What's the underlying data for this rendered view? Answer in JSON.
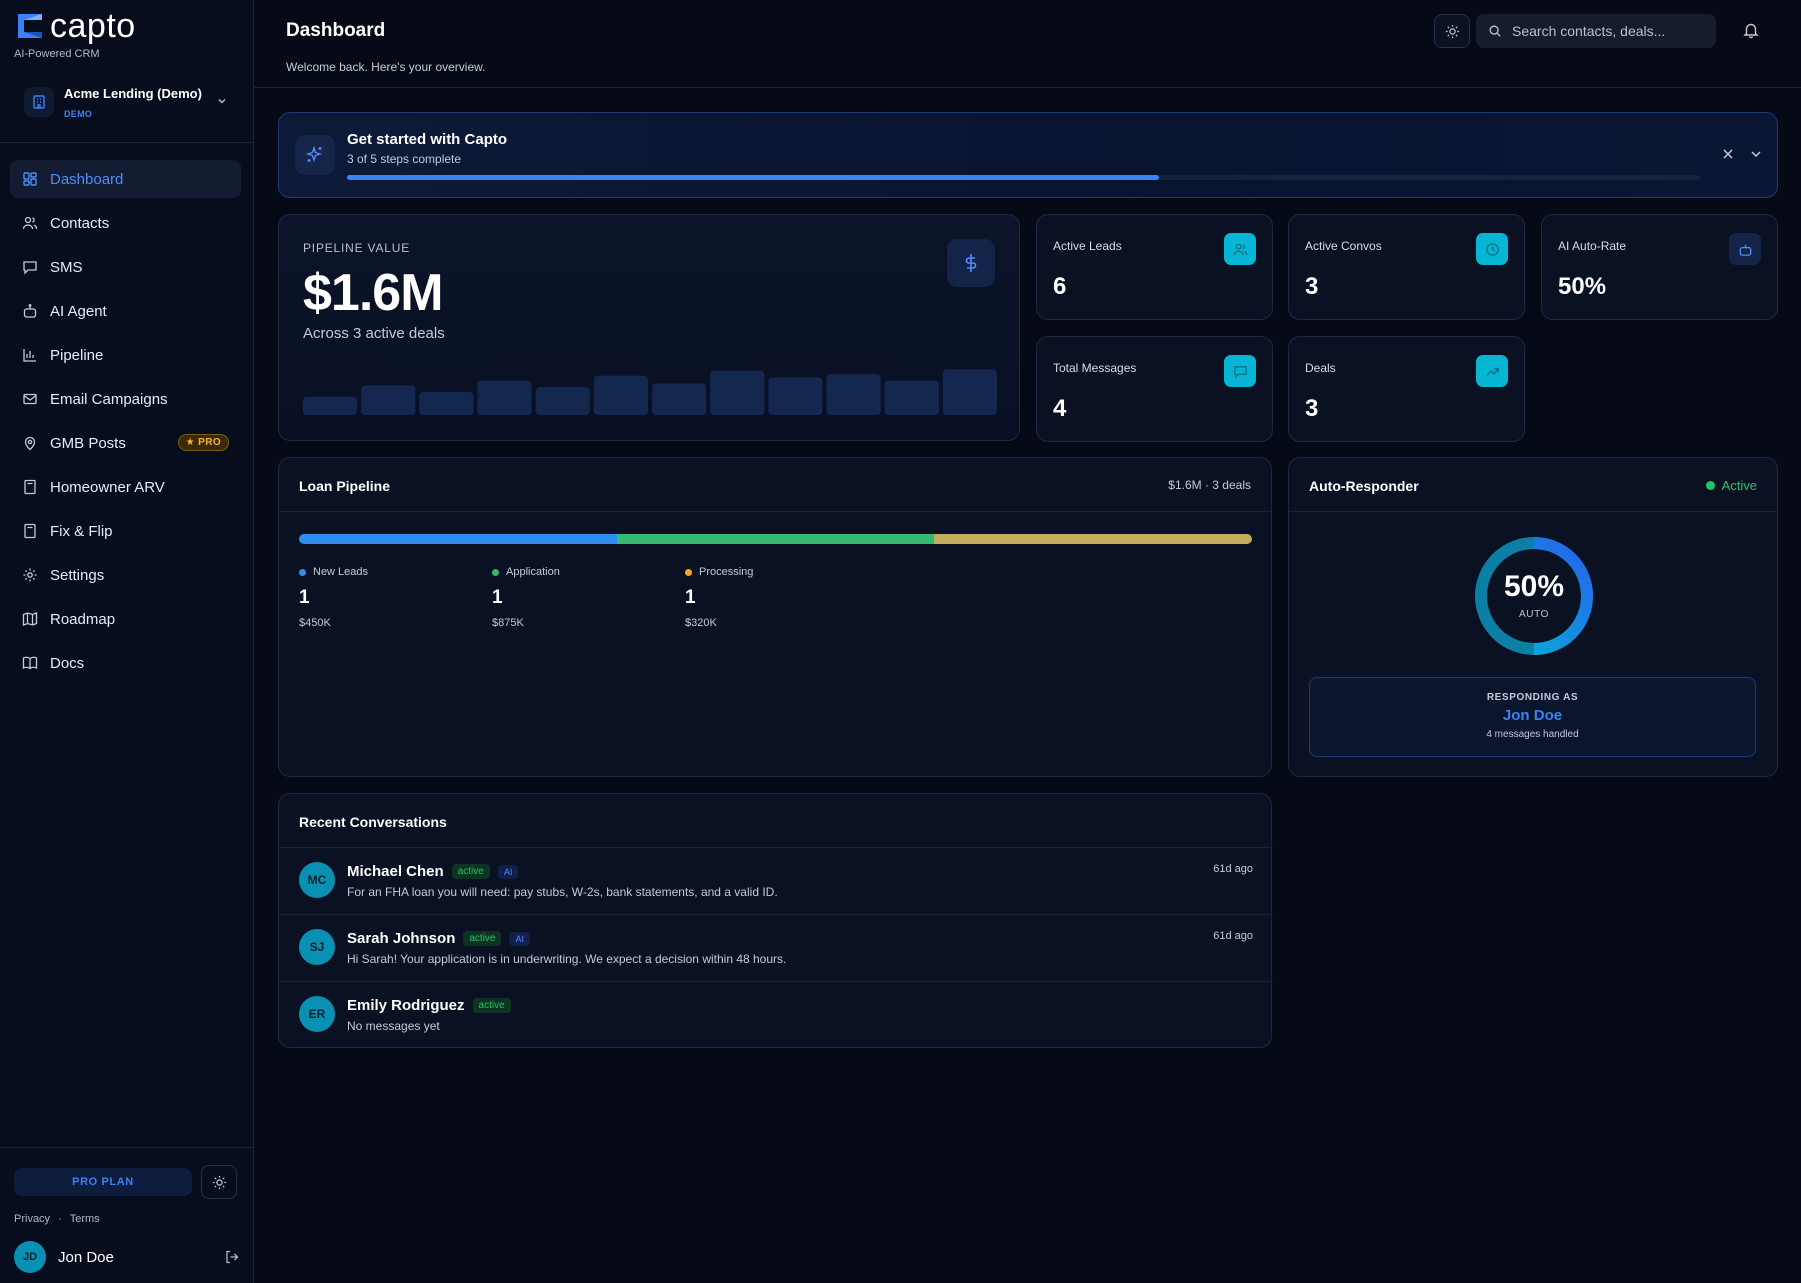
{
  "brand": {
    "name": "capto",
    "tagline": "AI-Powered CRM"
  },
  "org": {
    "name": "Acme Lending (Demo)",
    "badge": "DEMO"
  },
  "nav": [
    {
      "label": "Dashboard",
      "icon": "dashboard-icon",
      "active": true
    },
    {
      "label": "Contacts",
      "icon": "users-icon"
    },
    {
      "label": "SMS",
      "icon": "message-icon"
    },
    {
      "label": "AI Agent",
      "icon": "bot-icon"
    },
    {
      "label": "Pipeline",
      "icon": "bar-chart-icon"
    },
    {
      "label": "Email Campaigns",
      "icon": "mail-icon"
    },
    {
      "label": "GMB Posts",
      "icon": "map-pin-icon",
      "badge": "★ PRO"
    },
    {
      "label": "Homeowner ARV",
      "icon": "calculator-icon"
    },
    {
      "label": "Fix & Flip",
      "icon": "calculator-icon"
    },
    {
      "label": "Settings",
      "icon": "gear-icon"
    },
    {
      "label": "Roadmap",
      "icon": "map-icon"
    },
    {
      "label": "Docs",
      "icon": "book-icon"
    }
  ],
  "sidebar_footer": {
    "plan": "PRO PLAN",
    "privacy": "Privacy",
    "separator": "·",
    "terms": "Terms",
    "user_initials": "JD",
    "user_name": "Jon Doe"
  },
  "header": {
    "title": "Dashboard",
    "subtitle": "Welcome back. Here's your overview.",
    "search_placeholder": "Search contacts, deals..."
  },
  "onboarding": {
    "title": "Get started with Capto",
    "progress_text": "3 of 5 steps complete",
    "steps_done": 3,
    "steps_total": 5,
    "progress_fraction": 0.6
  },
  "pipeline_value": {
    "label": "PIPELINE VALUE",
    "value": "$1.6M",
    "subtitle": "Across 3 active deals",
    "sparkline": [
      0.38,
      0.62,
      0.48,
      0.72,
      0.58,
      0.82,
      0.66,
      0.92,
      0.78,
      0.85,
      0.72,
      0.95
    ]
  },
  "stats": [
    {
      "label": "Active Leads",
      "value": "6",
      "icon": "users-icon"
    },
    {
      "label": "Active Convos",
      "value": "3",
      "icon": "clock-icon"
    },
    {
      "label": "AI Auto-Rate",
      "value": "50%",
      "icon": "bot-icon"
    },
    {
      "label": "Total Messages",
      "value": "4",
      "icon": "message-square-icon"
    },
    {
      "label": "Deals",
      "value": "3",
      "icon": "trending-up-icon"
    }
  ],
  "loan_pipeline": {
    "title": "Loan Pipeline",
    "meta": "$1.6M · 3 deals",
    "stages": [
      {
        "name": "New Leads",
        "count": "1",
        "amount": "$450K",
        "color": "#2f8cf0"
      },
      {
        "name": "Application",
        "count": "1",
        "amount": "$875K",
        "color": "#34b874"
      },
      {
        "name": "Processing",
        "count": "1",
        "amount": "$320K",
        "color": "#f5a524"
      }
    ],
    "bar_colors": [
      "#2f8cf0",
      "#34b874",
      "#c2ad5c"
    ]
  },
  "auto_responder": {
    "title": "Auto-Responder",
    "status": "Active",
    "rate_text": "50%",
    "rate_fraction": 0.5,
    "rate_label": "AUTO",
    "responding_label": "RESPONDING AS",
    "responding_name": "Jon Doe",
    "handled": "4 messages handled"
  },
  "recent": {
    "title": "Recent Conversations",
    "conversations": [
      {
        "initials": "MC",
        "name": "Michael Chen",
        "status": "active",
        "ai": "AI",
        "message": "For an FHA loan you will need: pay stubs, W-2s, bank statements, and a valid ID.",
        "time": "61d ago"
      },
      {
        "initials": "SJ",
        "name": "Sarah Johnson",
        "status": "active",
        "ai": "AI",
        "message": "Hi Sarah! Your application is in underwriting. We expect a decision within 48 hours.",
        "time": "61d ago"
      },
      {
        "initials": "ER",
        "name": "Emily Rodriguez",
        "status": "active",
        "ai": "",
        "message": "No messages yet",
        "time": ""
      }
    ]
  }
}
